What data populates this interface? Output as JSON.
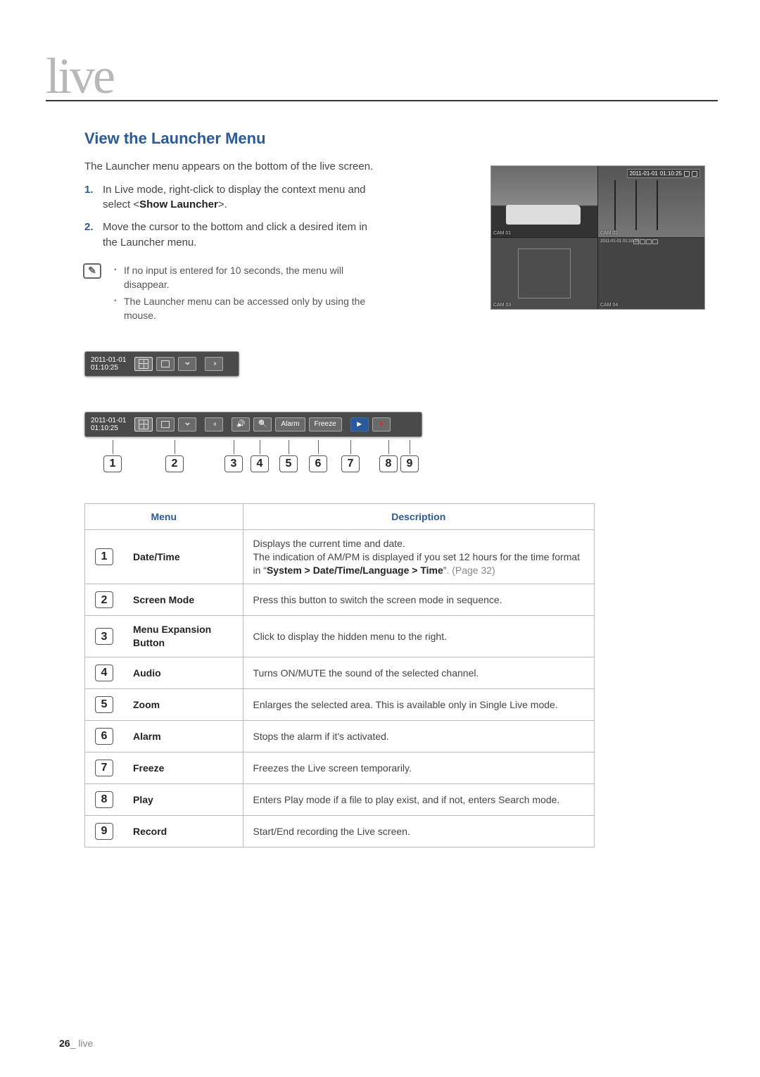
{
  "page": {
    "logo": "live",
    "number": "26",
    "footer_section": "live"
  },
  "section": {
    "title": "View the Launcher Menu",
    "intro": "The Launcher menu appears on the bottom of the live screen.",
    "step1_pre": "In Live mode, right-click to display the context menu and select <",
    "step1_bold": "Show Launcher",
    "step1_post": ">.",
    "step2": "Move the cursor to the bottom and click a desired item in the Launcher menu.",
    "note1": "If no input is entered for 10 seconds, the menu will disappear.",
    "note2": "The Launcher menu can be accessed only by using the mouse."
  },
  "dvr": {
    "overlay_date": "2011-01-01",
    "overlay_time": "01:10:25",
    "cam1": "CAM 01",
    "cam2": "CAM 02",
    "cam3": "CAM 03",
    "cam4": "CAM 04",
    "mini_stamp": "2011-01-01\n01:10:25"
  },
  "bar": {
    "date": "2011-01-01",
    "time": "01:10:25",
    "alarm": "Alarm",
    "freeze": "Freeze"
  },
  "callouts": {
    "n1": "1",
    "n2": "2",
    "n3": "3",
    "n4": "4",
    "n5": "5",
    "n6": "6",
    "n7": "7",
    "n8": "8",
    "n9": "9"
  },
  "table": {
    "head_menu": "Menu",
    "head_desc": "Description",
    "rows": [
      {
        "num": "1",
        "name": "Date/Time",
        "desc_line1": "Displays the current time and date.",
        "desc_line2_pre": "The indication of AM/PM is displayed if you set 12 hours for the time format in ",
        "desc_path_open": "“",
        "desc_path": "System > Date/Time/Language > Time",
        "desc_path_close": "”",
        "desc_pageref": ". (Page 32)"
      },
      {
        "num": "2",
        "name": "Screen Mode",
        "desc": "Press this button to switch the screen mode in sequence."
      },
      {
        "num": "3",
        "name": "Menu Expansion Button",
        "desc": "Click to display the hidden menu to the right."
      },
      {
        "num": "4",
        "name": "Audio",
        "desc": "Turns ON/MUTE the sound of the selected channel."
      },
      {
        "num": "5",
        "name": "Zoom",
        "desc": "Enlarges the selected area. This is available only in Single Live mode."
      },
      {
        "num": "6",
        "name": "Alarm",
        "desc": "Stops the alarm if it's activated."
      },
      {
        "num": "7",
        "name": "Freeze",
        "desc": "Freezes the Live screen temporarily."
      },
      {
        "num": "8",
        "name": "Play",
        "desc": "Enters Play mode if a file to play exist, and if not, enters Search mode."
      },
      {
        "num": "9",
        "name": "Record",
        "desc": "Start/End recording the Live screen."
      }
    ]
  }
}
